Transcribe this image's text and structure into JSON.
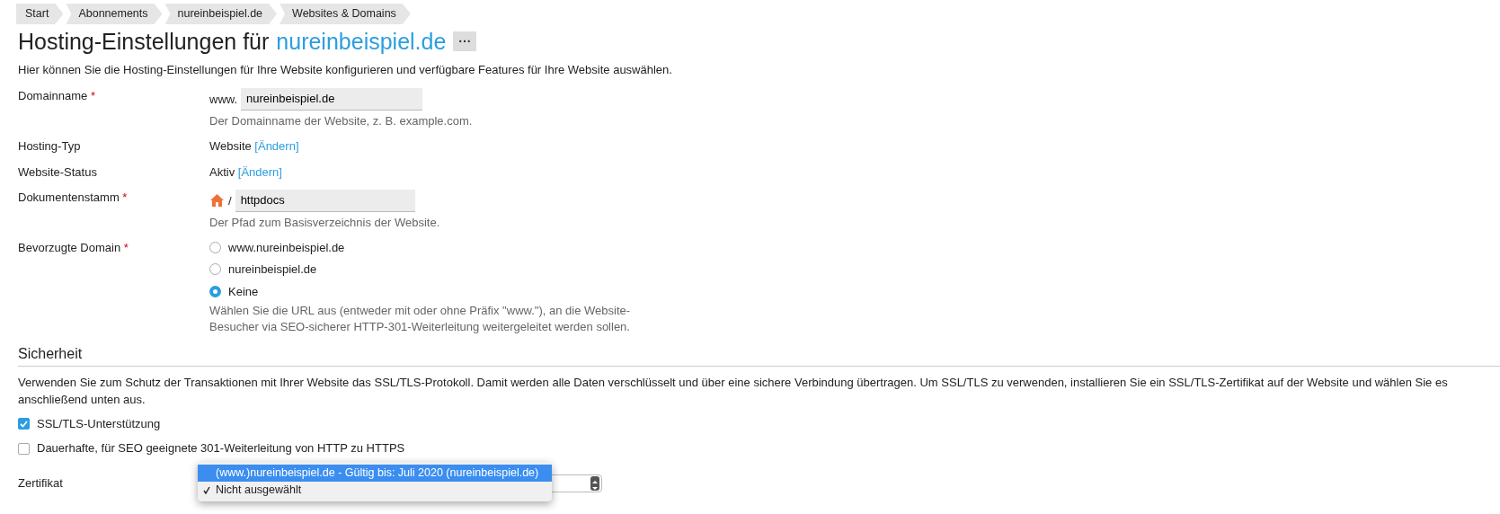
{
  "breadcrumb": [
    {
      "label": "Start"
    },
    {
      "label": "Abonnements"
    },
    {
      "label": "nureinbeispiel.de"
    },
    {
      "label": "Websites & Domains"
    }
  ],
  "title": {
    "text": "Hosting-Einstellungen für",
    "domain": "nureinbeispiel.de",
    "more_button": "···"
  },
  "intro": "Hier können Sie die Hosting-Einstellungen für Ihre Website konfigurieren und verfügbare Features für Ihre Website auswählen.",
  "fields": [
    {
      "kind": "text",
      "label": "Domainname",
      "required_mark": "*",
      "prefix": "www.",
      "value": "nureinbeispiel.de",
      "hint": "Der Domainname der Website, z. B. example.com."
    },
    {
      "kind": "static",
      "label": "Hosting-Typ",
      "value": "Website",
      "link": "[Ändern]"
    },
    {
      "kind": "static",
      "label": "Website-Status",
      "value": "Aktiv",
      "link": "[Ändern]"
    },
    {
      "kind": "path",
      "label": "Dokumentenstamm",
      "required_mark": "*",
      "prefix": "/",
      "value": "httpdocs",
      "hint": "Der Pfad zum Basisverzeichnis der Website."
    },
    {
      "kind": "radio",
      "label": "Bevorzugte Domain",
      "required_mark": "*",
      "options": [
        {
          "label": "www.nureinbeispiel.de",
          "selected": false
        },
        {
          "label": "nureinbeispiel.de",
          "selected": false
        },
        {
          "label": "Keine",
          "selected": true
        }
      ],
      "hint": "Wählen Sie die URL aus (entweder mit oder ohne Präfix \"www.\"), an die Website-Besucher via SEO-sicherer HTTP-301-Weiterleitung weitergeleitet werden sollen."
    }
  ],
  "security": {
    "heading": "Sicherheit",
    "text": "Verwenden Sie zum Schutz der Transaktionen mit Ihrer Website das SSL/TLS-Protokoll. Damit werden alle Daten verschlüsselt und über eine sichere Verbindung übertragen. Um SSL/TLS zu verwenden, installieren Sie ein SSL/TLS-Zertifikat auf der Website und wählen Sie es anschließend unten aus.",
    "checkboxes": [
      {
        "label": "SSL/TLS-Unterstützung",
        "checked": true
      },
      {
        "label": "Dauerhafte, für SEO geeignete 301-Weiterleitung von HTTP zu HTTPS",
        "checked": false
      }
    ],
    "certificate": {
      "label": "Zertifikat",
      "options": [
        {
          "label": "(www.)nureinbeispiel.de - Gültig bis: Juli 2020 (nureinbeispiel.de)",
          "selected": false,
          "highlighted": true
        },
        {
          "label": "Nicht ausgewählt",
          "selected": true,
          "highlighted": false
        }
      ]
    }
  }
}
